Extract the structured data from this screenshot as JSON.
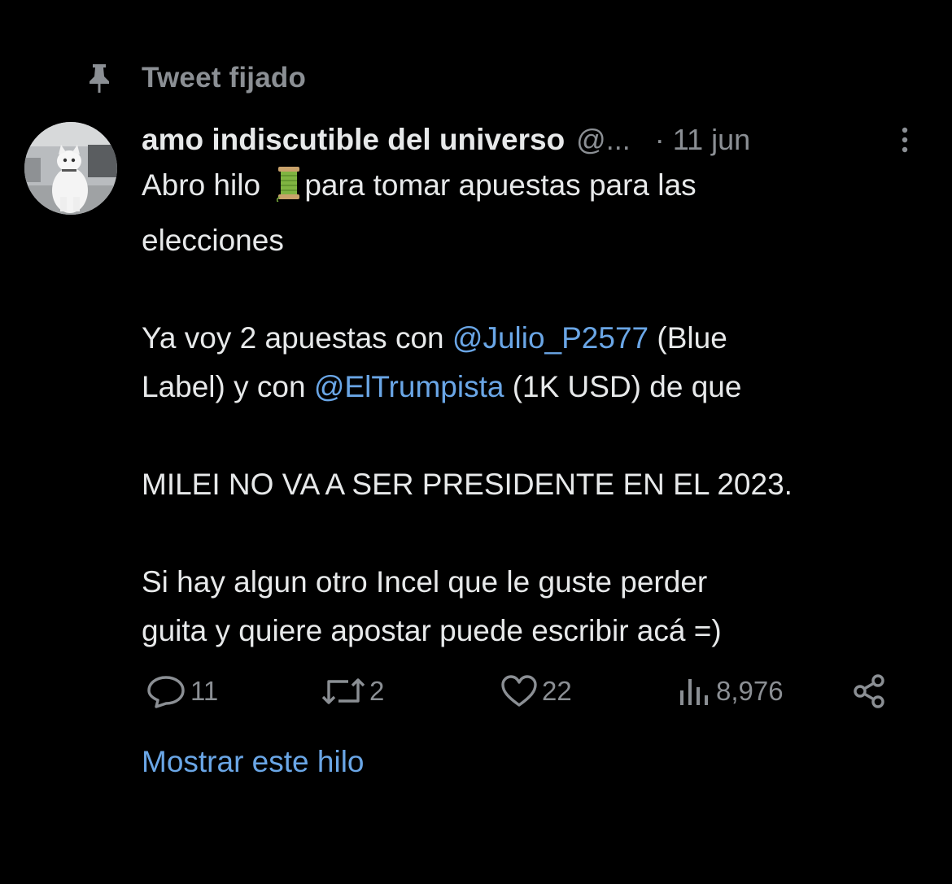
{
  "pinned": {
    "label": "Tweet fijado",
    "icon": "pin-icon"
  },
  "tweet": {
    "author_name": "amo indiscutible del universo",
    "handle": "@...",
    "date": "· 11 jun",
    "body": {
      "line1_text": "Abro hilo ",
      "line1_emoji": "thread-spool-emoji",
      "line1_rest": "para tomar apuestas para las",
      "line2": "elecciones",
      "p2_part1": "Ya voy 2 apuestas con ",
      "p2_mention1": "@Julio_P2577",
      "p2_part2": " (Blue",
      "p2_part3": "Label) y con ",
      "p2_mention2": "@ElTrumpista",
      "p2_part4": " (1K USD) de que",
      "p3": "MILEI NO VA A SER PRESIDENTE EN EL 2023.",
      "p4_line1": "Si hay algun otro Incel que le guste perder",
      "p4_line2": "guita y quiere  apostar puede escribir acá =)"
    },
    "actions": {
      "replies": "11",
      "retweets": "2",
      "likes": "22",
      "views": "8,976"
    },
    "show_thread": "Mostrar este hilo"
  },
  "colors": {
    "background": "#000000",
    "text_primary": "#e7e9ea",
    "text_secondary": "#8b8f94",
    "link": "#6aa6e6"
  }
}
